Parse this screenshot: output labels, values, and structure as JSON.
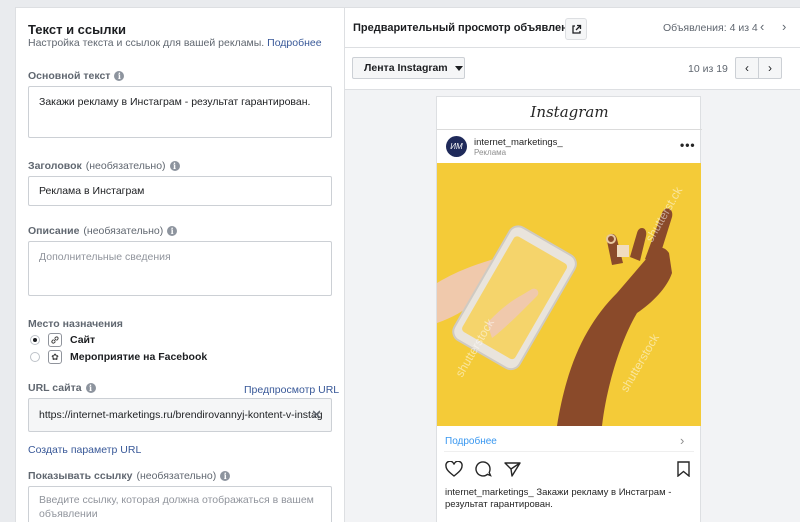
{
  "left": {
    "title": "Текст и ссылки",
    "subtitle": "Настройка текста и ссылок для вашей рекламы.",
    "subtitle_link": "Подробнее",
    "primary_text": {
      "label": "Основной текст",
      "value": "Закажи рекламу в Инстаграм - результат гарантирован."
    },
    "headline": {
      "label": "Заголовок",
      "optional": "(необязательно)",
      "value": "Реклама в Инстаграм"
    },
    "description": {
      "label": "Описание",
      "optional": "(необязательно)",
      "placeholder": "Дополнительные сведения"
    },
    "destination": {
      "label": "Место назначения",
      "options": [
        {
          "label": "Сайт",
          "checked": true,
          "icon": "link-icon"
        },
        {
          "label": "Мероприятие на Facebook",
          "checked": false,
          "icon": "event-icon"
        }
      ]
    },
    "website_url": {
      "label": "URL сайта",
      "preview_link": "Предпросмотр URL",
      "value": "https://internet-marketings.ru/brendirovannyj-kontent-v-instag"
    },
    "create_url_param": "Создать параметр URL",
    "display_link": {
      "label": "Показывать ссылку",
      "optional": "(необязательно)",
      "placeholder": "Введите ссылку, которая должна отображаться в вашем объявлении"
    }
  },
  "right": {
    "title": "Предварительный просмотр объявлений",
    "ads_count": "Объявления: 4 из 4",
    "placement_dropdown": "Лента Instagram",
    "page_indicator": "10 из 19",
    "preview": {
      "platform_logo": "Instagram",
      "account_name": "internet_marketings_",
      "sponsored": "Реклама",
      "learn_more": "Подробнее",
      "caption": "internet_marketings_ Закажи рекламу в Инстаграм - результат гарантирован."
    }
  },
  "colors": {
    "link": "#385898",
    "ig_link": "#3897f0",
    "ad_background": "#f3c72f"
  }
}
